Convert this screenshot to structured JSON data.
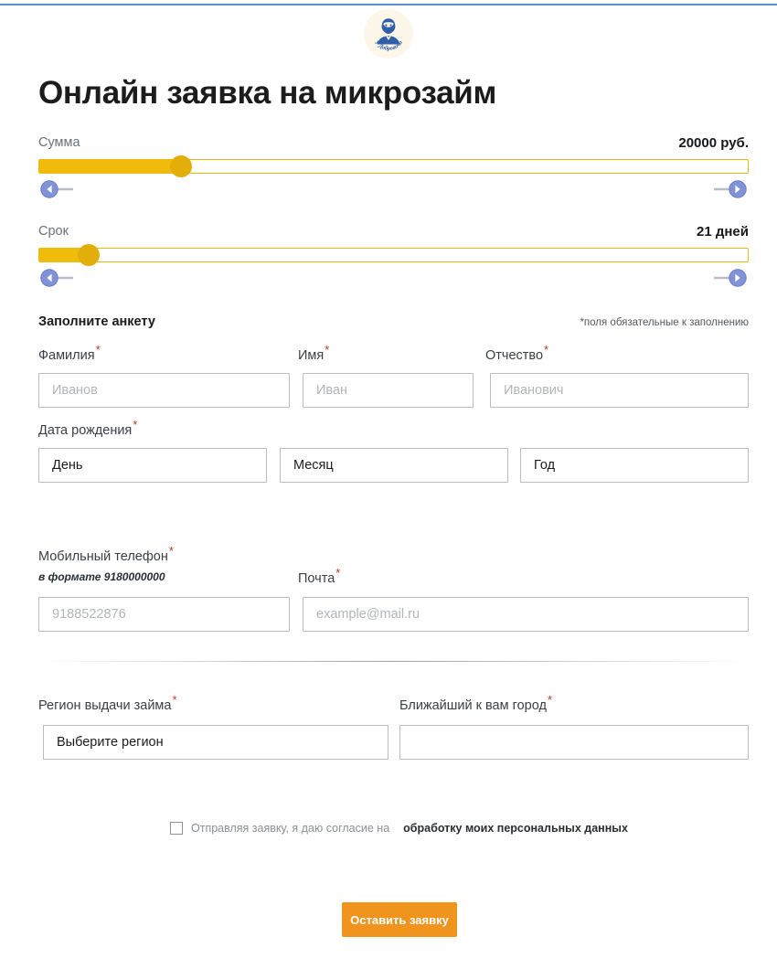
{
  "brand": {
    "logo_alt": "У Добровича",
    "logo_bg": "#fdf7ea",
    "logo_color": "#2f5fa8",
    "top_rule_color": "#5b8fc9"
  },
  "page_title": "Онлайн заявка на микрозайм",
  "sliders": [
    {
      "label": "Сумма",
      "value_text": "20000 руб.",
      "fill_percent": 20,
      "thumb_percent": 20,
      "decrease_icon": "arrow-left-icon",
      "increase_icon": "arrow-right-icon"
    },
    {
      "label": "Срок",
      "value_text": "21 дней",
      "fill_percent": 7,
      "thumb_percent": 7,
      "decrease_icon": "arrow-left-icon",
      "increase_icon": "arrow-right-icon"
    }
  ],
  "form": {
    "heading": "Заполните анкету",
    "required_note": "*поля обязательные к заполнению",
    "last_name": {
      "label": "Фамилия",
      "required": "*",
      "placeholder": "Иванов",
      "value": ""
    },
    "first_name": {
      "label": "Имя",
      "required": "*",
      "placeholder": "Иван",
      "value": ""
    },
    "middle_name": {
      "label": "Отчество",
      "required": "*",
      "placeholder": "Иванович",
      "value": ""
    },
    "birth_date": {
      "label": "Дата рождения",
      "required": "*",
      "day": "День",
      "month": "Месяц",
      "year": "Год"
    },
    "phone": {
      "label": "Мобильный телефон",
      "required": "*",
      "hint": "в формате 9180000000",
      "placeholder": "9188522876",
      "value": ""
    },
    "email": {
      "label": "Почта",
      "required": "*",
      "placeholder": "example@mail.ru",
      "value": ""
    },
    "region": {
      "label": "Регион выдачи займа",
      "required": "*",
      "value": "Выберите регион"
    },
    "city": {
      "label": "Ближайший к вам город",
      "required": "*",
      "value": ""
    },
    "consent": {
      "text": "Отправляя заявку, я даю согласие на",
      "link": "обработку моих персональных данных",
      "checked": false
    },
    "submit_label": "Оставить заявку"
  },
  "colors": {
    "slider_track": "#f0bc0c",
    "slider_border": "#f0b90b",
    "slider_thumb": "#e3ae09",
    "submit_bg": "#f0941e",
    "required_star": "#c0392b"
  }
}
